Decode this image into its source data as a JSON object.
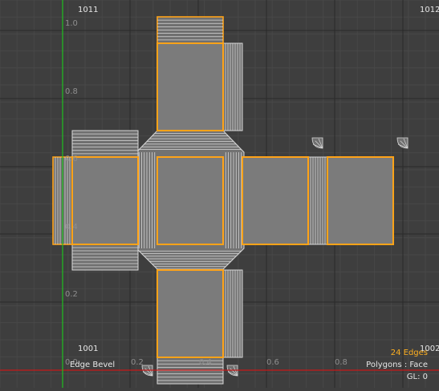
{
  "viewport": {
    "udim_top_left": "1011",
    "udim_top_right": "1012",
    "udim_bottom_left": "1001",
    "udim_bottom_right": "1002",
    "v_ticks": [
      "1.0",
      "0.8",
      "0.6",
      "0.4",
      "0.2",
      "0.0"
    ],
    "u_ticks": [
      "0.0",
      "0.2",
      "0.4",
      "0.6",
      "0.8"
    ],
    "tool_label": "Edge Bevel"
  },
  "status": {
    "selection_count": "24 Edges",
    "mode": "Polygons : Face",
    "gl": "GL: 0"
  },
  "colors": {
    "background": "#3e3e3e",
    "selection": "#ffa318",
    "face_fill": "#7b7b7b",
    "wire": "#d8d8d8",
    "v_axis": "#1fc01f",
    "u_axis": "#c81818"
  }
}
